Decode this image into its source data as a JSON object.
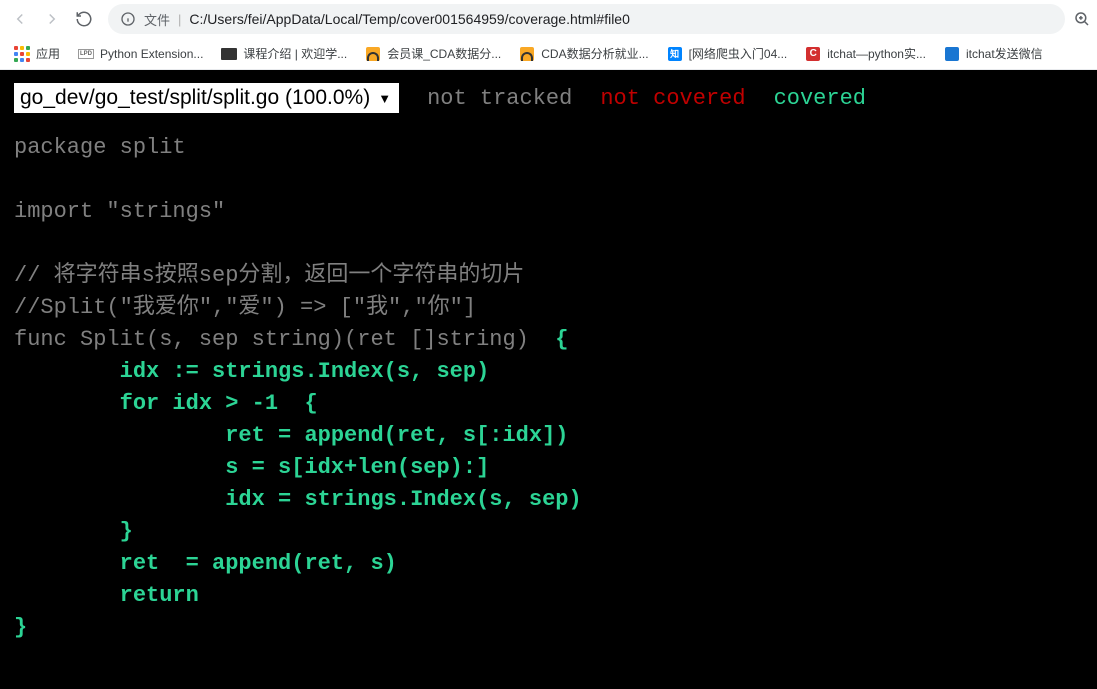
{
  "toolbar": {
    "url_prefix_label": "文件",
    "url": "C:/Users/fei/AppData/Local/Temp/cover001564959/coverage.html#file0"
  },
  "bookmarks": {
    "apps": "应用",
    "items": [
      {
        "label": "Python Extension..."
      },
      {
        "label": "课程介绍 | 欢迎学..."
      },
      {
        "label": "会员课_CDA数据分..."
      },
      {
        "label": "CDA数据分析就业..."
      },
      {
        "label": "[网络爬虫入门04..."
      },
      {
        "label": "itchat—python实..."
      },
      {
        "label": "itchat发送微信"
      }
    ],
    "lpd_text": "LPD",
    "zh_text": "知",
    "red_text": "C"
  },
  "coverage": {
    "file_selector": "go_dev/go_test/split/split.go (100.0%)",
    "legend": {
      "not_tracked": "not tracked",
      "not_covered": "not covered",
      "covered": "covered"
    },
    "code": {
      "l1": "package split",
      "l2": "",
      "l3": "import \"strings\"",
      "l4": "",
      "l5": "// 将字符串s按照sep分割，返回一个字符串的切片",
      "l6": "//Split(\"我爱你\",\"爱\") => [\"我\",\"你\"]",
      "l7a": "func Split(s, sep string)(ret []string)  ",
      "l7b": "{",
      "l8": "        idx := strings.Index(s, sep)",
      "l9": "        for idx > -1  {",
      "l10": "                ret = append(ret, s[:idx])",
      "l11": "                s = s[idx+len(sep):]",
      "l12": "                idx = strings.Index(s, sep)",
      "l13": "        }",
      "l14": "        ret  = append(ret, s)",
      "l15": "        return",
      "l16": "}"
    }
  }
}
